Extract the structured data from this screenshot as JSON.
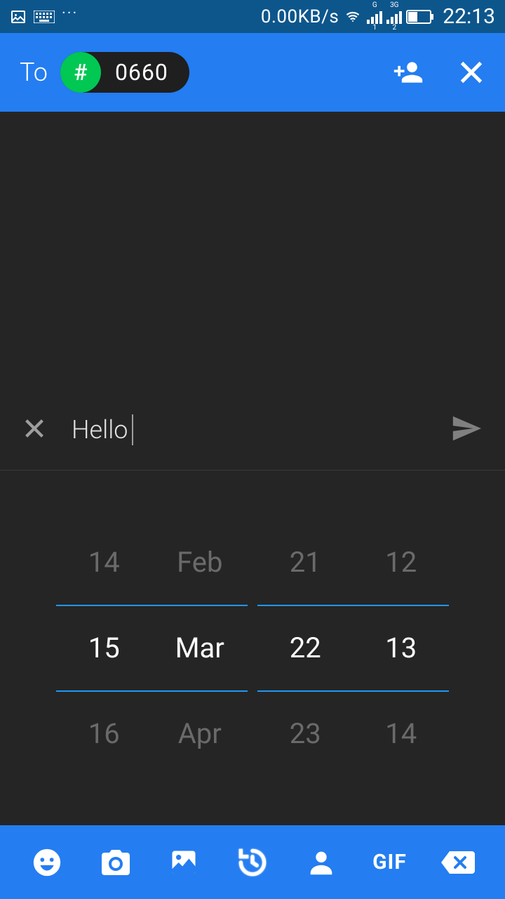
{
  "status": {
    "speed": "0.00KB/s",
    "time": "22:13"
  },
  "header": {
    "to_label": "To",
    "chip_hash": "#",
    "chip_number": "0660"
  },
  "input": {
    "message": "Hello"
  },
  "picker": {
    "day": {
      "prev": "14",
      "sel": "15",
      "next": "16"
    },
    "month": {
      "prev": "Feb",
      "sel": "Mar",
      "next": "Apr"
    },
    "hour": {
      "prev": "21",
      "sel": "22",
      "next": "23"
    },
    "minute": {
      "prev": "12",
      "sel": "13",
      "next": "14"
    }
  },
  "toolbar": {
    "gif": "GIF"
  }
}
